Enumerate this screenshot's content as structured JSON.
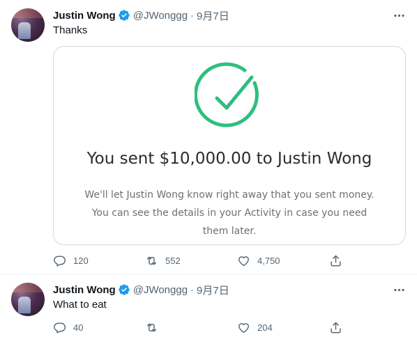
{
  "tweets": [
    {
      "author_name": "Justin Wong",
      "handle": "@JWonggg",
      "separator": "·",
      "date": "9月7日",
      "text": "Thanks",
      "card": {
        "title": "You sent $10,000.00 to Justin Wong",
        "body": "We'll let Justin Wong know right away that you sent money. You can see the details in your Activity in case you need them later.",
        "icon": "check-circle-icon"
      },
      "stats": {
        "replies": "120",
        "retweets": "552",
        "likes": "4,750"
      }
    },
    {
      "author_name": "Justin Wong",
      "handle": "@JWonggg",
      "separator": "·",
      "date": "9月7日",
      "text": "What to eat",
      "stats": {
        "replies": "40",
        "retweets": "",
        "likes": "204"
      }
    }
  ],
  "colors": {
    "verified": "#1d9bf0",
    "secondary_text": "#536471",
    "check_green": "#2ebf7f",
    "border": "#cfd9de"
  }
}
